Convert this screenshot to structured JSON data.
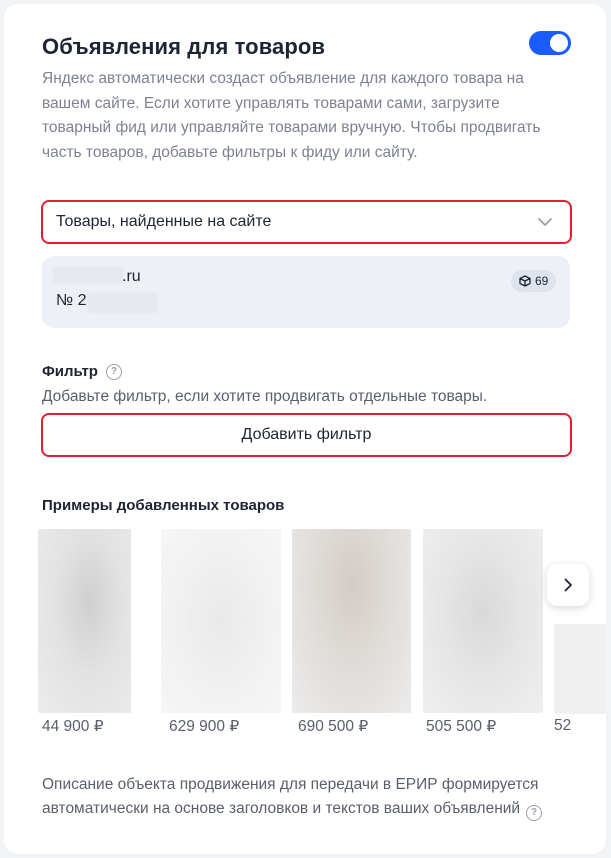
{
  "header": {
    "title": "Объявления для товаров",
    "toggle_on": true
  },
  "description": "Яндекс автоматически создаст объявление для каждого товара на вашем сайте. Если хотите управлять товарами сами, загрузите товарный фид или управляйте товарами вручную. Чтобы продвигать часть товаров, добавьте фильтры к фиду или сайту.",
  "source_select": {
    "value": "Товары, найденные на сайте"
  },
  "source_card": {
    "domain": ".ru",
    "number": "№ 2",
    "count": "69"
  },
  "filter": {
    "title": "Фильтр",
    "description": "Добавьте фильтр, если хотите продвигать отдельные товары.",
    "add_button": "Добавить фильтр"
  },
  "examples": {
    "title": "Примеры добавленных товаров",
    "products": [
      {
        "price": "44 900 ₽"
      },
      {
        "price": "629 900 ₽"
      },
      {
        "price": "690 500 ₽"
      },
      {
        "price": "505 500 ₽"
      },
      {
        "price": "52"
      }
    ]
  },
  "footer": {
    "text": "Описание объекта продвижения для передачи в ЕРИР формируется автоматически на основе заголовков и текстов ваших объявлений"
  },
  "colors": {
    "accent": "#1a5cff",
    "highlight_border": "#e0202e"
  }
}
